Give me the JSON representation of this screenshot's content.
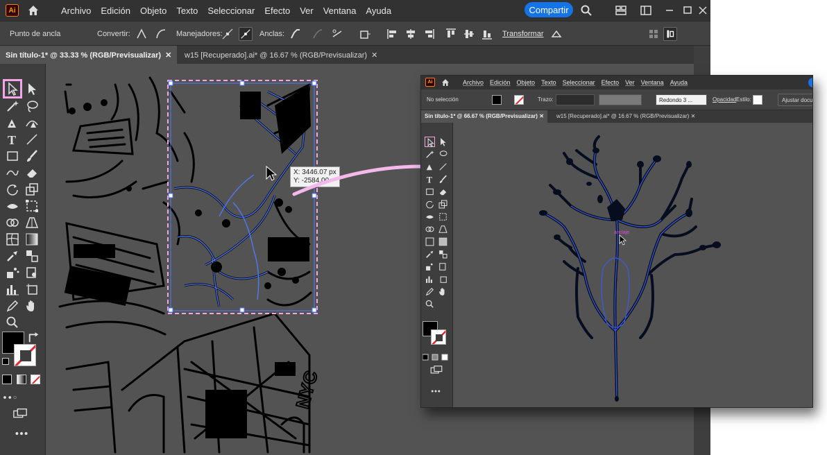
{
  "colors": {
    "accent": "#1473e6",
    "selection": "#f4a6e6",
    "arrow": "#f4b8ec",
    "path_blue": "#4f7bff",
    "canvas_gray": "#535353"
  },
  "main": {
    "app_logo": "Ai",
    "menus": [
      "Archivo",
      "Edición",
      "Objeto",
      "Texto",
      "Seleccionar",
      "Efecto",
      "Ver",
      "Ventana",
      "Ayuda"
    ],
    "share_label": "Compartir",
    "control_bar": {
      "anchor_label": "Punto de ancla",
      "convert_label": "Convertir:",
      "handles_label": "Manejadores:",
      "anchors_label": "Anclas:",
      "transform_label": "Transformar"
    },
    "tabs": [
      {
        "label": "Sin título-1* @ 33.33 % (RGB/Previsualizar)",
        "close": "✕"
      },
      {
        "label": "w15 [Recuperado].ai* @ 16.67 % (RGB/Previsualizar)",
        "close": "✕"
      }
    ],
    "tooltip": {
      "x": "X: 3446.07 px",
      "y": "Y: -2584.00"
    },
    "canvas_text": "NYC",
    "icons": [
      "home-icon",
      "search-icon",
      "arrange-icon",
      "workspace-icon",
      "minimize-icon",
      "maximize-icon",
      "close-icon",
      "selection-tool-icon",
      "direct-selection-tool-icon",
      "magic-wand-icon",
      "lasso-icon",
      "pen-icon",
      "curvature-icon",
      "type-icon",
      "line-icon",
      "rectangle-icon",
      "paintbrush-icon",
      "shaper-icon",
      "eraser-icon",
      "rotate-icon",
      "scale-icon",
      "width-icon",
      "free-transform-icon",
      "shape-builder-icon",
      "perspective-icon",
      "mesh-icon",
      "gradient-icon",
      "eyedropper-icon",
      "blend-icon",
      "symbol-sprayer-icon",
      "graph-icon",
      "artboard-icon",
      "slice-icon",
      "hand-icon",
      "zoom-icon",
      "more-tools-icon"
    ]
  },
  "inset": {
    "app_logo": "Ai",
    "menus": [
      "Archivo",
      "Edición",
      "Objeto",
      "Texto",
      "Seleccionar",
      "Efecto",
      "Ver",
      "Ventana",
      "Ayuda"
    ],
    "control_bar": {
      "selection_label": "No selección",
      "stroke_label": "Trazo:",
      "brush_label": "Redondo 3 ...",
      "opacity_label": "Opacidad",
      "style_label": "Estilo:",
      "fit_label": "Ajustar docu"
    },
    "tabs": [
      {
        "label": "Sin título-1* @ 66.67 % (RGB/Previsualizar)",
        "close": "✕"
      },
      {
        "label": "w15 [Recuperado].ai* @ 16.67 % (RGB/Previsualizar)",
        "close": "✕"
      }
    ],
    "anchor_hint": "anclaje"
  }
}
